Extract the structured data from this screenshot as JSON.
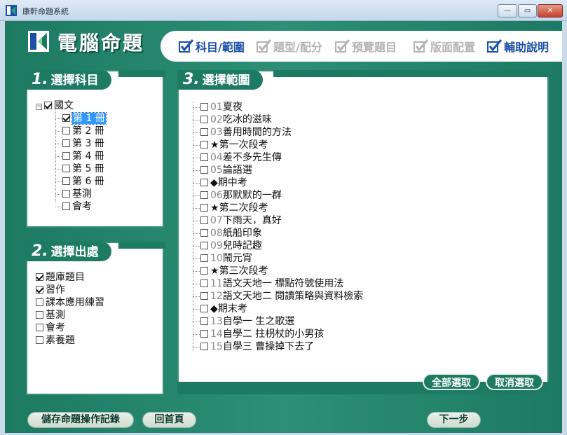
{
  "window": {
    "title": "康軒命題系統",
    "min": "—",
    "max": "▭",
    "close": "✕"
  },
  "app": {
    "title": "電腦命題"
  },
  "steps": [
    {
      "label": "科目/範圍",
      "state": "active"
    },
    {
      "label": "題型/配分",
      "state": "inactive"
    },
    {
      "label": "預覽題目",
      "state": "inactive"
    },
    {
      "label": "版面配置",
      "state": "inactive"
    },
    {
      "label": "輔助說明",
      "state": "active"
    }
  ],
  "subject_panel": {
    "num": "1.",
    "title": "選擇科目",
    "root": {
      "label": "國文",
      "checked": true
    },
    "children": [
      {
        "label": "第 1 冊",
        "checked": true,
        "selected": true
      },
      {
        "label": "第 2 冊",
        "checked": false
      },
      {
        "label": "第 3 冊",
        "checked": false
      },
      {
        "label": "第 4 冊",
        "checked": false
      },
      {
        "label": "第 5 冊",
        "checked": false
      },
      {
        "label": "第 6 冊",
        "checked": false
      },
      {
        "label": "基測",
        "checked": false
      },
      {
        "label": "會考",
        "checked": false
      }
    ]
  },
  "source_panel": {
    "num": "2.",
    "title": "選擇出處",
    "items": [
      {
        "label": "題庫題目",
        "checked": true
      },
      {
        "label": "習作",
        "checked": true
      },
      {
        "label": "課本應用練習",
        "checked": false
      },
      {
        "label": "基測",
        "checked": false
      },
      {
        "label": "會考",
        "checked": false
      },
      {
        "label": "素養題",
        "checked": false
      }
    ]
  },
  "range_panel": {
    "num": "3.",
    "title": "選擇範圍",
    "items": [
      {
        "num": "01",
        "label": "夏夜"
      },
      {
        "num": "02",
        "label": "吃冰的滋味"
      },
      {
        "num": "03",
        "label": "善用時間的方法"
      },
      {
        "num": "",
        "label": "★第一次段考"
      },
      {
        "num": "04",
        "label": "差不多先生傳"
      },
      {
        "num": "05",
        "label": "論語選"
      },
      {
        "num": "",
        "label": "◆期中考"
      },
      {
        "num": "06",
        "label": "那默默的一群"
      },
      {
        "num": "",
        "label": "★第二次段考"
      },
      {
        "num": "07",
        "label": "下雨天，真好"
      },
      {
        "num": "08",
        "label": "紙船印象"
      },
      {
        "num": "09",
        "label": "兒時記趣"
      },
      {
        "num": "10",
        "label": "鬧元宵"
      },
      {
        "num": "",
        "label": "★第三次段考"
      },
      {
        "num": "11",
        "label": "語文天地一  標點符號使用法"
      },
      {
        "num": "12",
        "label": "語文天地二  閱讀策略與資料檢索"
      },
      {
        "num": "",
        "label": "◆期末考"
      },
      {
        "num": "13",
        "label": "自學一  生之歌選"
      },
      {
        "num": "14",
        "label": "自學二  拄枴杖的小男孩"
      },
      {
        "num": "15",
        "label": "自學三  曹操掉下去了"
      }
    ],
    "select_all": "全部選取",
    "deselect_all": "取消選取"
  },
  "footer": {
    "save_log": "儲存命題操作記錄",
    "home": "回首頁",
    "next": "下一步"
  },
  "colors": {
    "brand_green": "#1d7a63",
    "step_active": "#1b4fa8",
    "step_inactive": "#b4b4b4",
    "selection": "#3399ff"
  }
}
